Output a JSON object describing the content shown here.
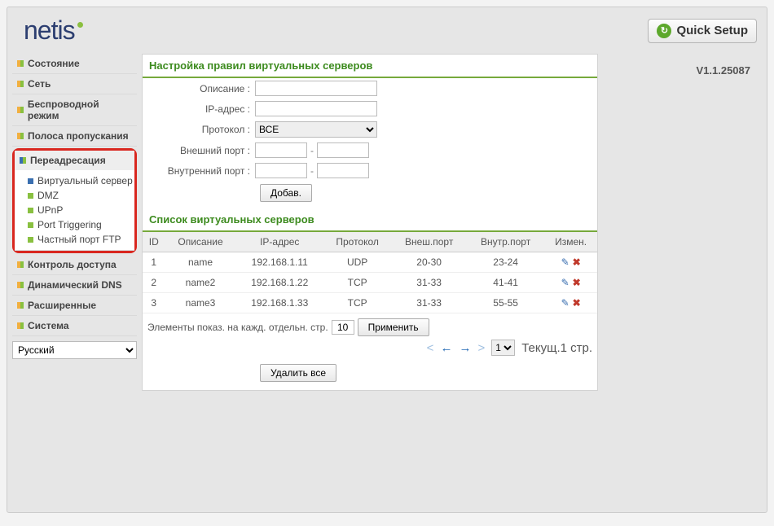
{
  "brand": "netis",
  "quick_setup_label": "Quick Setup",
  "version": "V1.1.25087",
  "sidebar": {
    "items": [
      {
        "label": "Состояние"
      },
      {
        "label": "Сеть"
      },
      {
        "label": "Беспроводной режим"
      },
      {
        "label": "Полоса пропускания"
      },
      {
        "label": "Переадресация"
      },
      {
        "label": "Контроль доступа"
      },
      {
        "label": "Динамический DNS"
      },
      {
        "label": "Расширенные"
      },
      {
        "label": "Система"
      }
    ],
    "sub_forwarding": [
      {
        "label": "Виртуальный сервер",
        "active": true
      },
      {
        "label": "DMZ",
        "active": false
      },
      {
        "label": "UPnP",
        "active": false
      },
      {
        "label": "Port Triggering",
        "active": false
      },
      {
        "label": "Частный порт FTP",
        "active": false
      }
    ]
  },
  "lang_selected": "Русский",
  "form": {
    "title": "Настройка правил виртуальных серверов",
    "labels": {
      "desc": "Описание :",
      "ip": "IP-адрес :",
      "proto": "Протокол :",
      "ext": "Внешний порт :",
      "int": "Внутренний порт :"
    },
    "proto_selected": "ВСЕ",
    "add_btn": "Добав."
  },
  "list": {
    "title": "Список виртуальных серверов",
    "headers": {
      "id": "ID",
      "desc": "Описание",
      "ip": "IP-адрес",
      "proto": "Протокол",
      "ext": "Внеш.порт",
      "int": "Внутр.порт",
      "edit": "Измен."
    },
    "rows": [
      {
        "id": "1",
        "desc": "name",
        "ip": "192.168.1.11",
        "proto": "UDP",
        "ext": "20-30",
        "int": "23-24"
      },
      {
        "id": "2",
        "desc": "name2",
        "ip": "192.168.1.22",
        "proto": "TCP",
        "ext": "31-33",
        "int": "41-41"
      },
      {
        "id": "3",
        "desc": "name3",
        "ip": "192.168.1.33",
        "proto": "TCP",
        "ext": "31-33",
        "int": "55-55"
      }
    ]
  },
  "pager": {
    "per_page_label": "Элементы показ. на кажд. отдельн. стр.",
    "per_page_value": "10",
    "apply": "Применить",
    "page_selected": "1",
    "status": "Текущ.1 стр.",
    "delete_all": "Удалить все"
  }
}
